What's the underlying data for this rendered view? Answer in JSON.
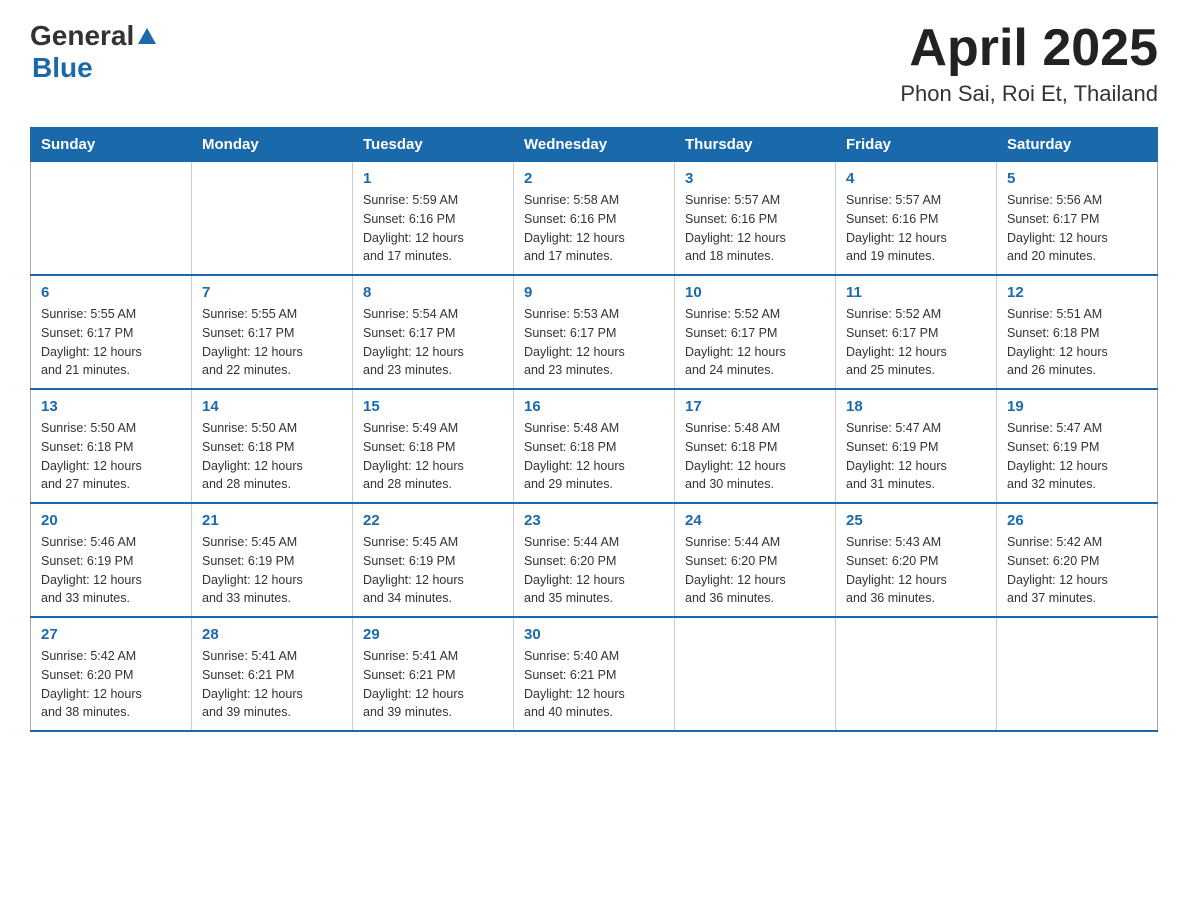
{
  "header": {
    "logo": {
      "general": "General",
      "blue": "Blue",
      "arrow": "▲"
    },
    "title": "April 2025",
    "subtitle": "Phon Sai, Roi Et, Thailand"
  },
  "calendar": {
    "weekdays": [
      "Sunday",
      "Monday",
      "Tuesday",
      "Wednesday",
      "Thursday",
      "Friday",
      "Saturday"
    ],
    "weeks": [
      [
        {
          "day": "",
          "info": ""
        },
        {
          "day": "",
          "info": ""
        },
        {
          "day": "1",
          "info": "Sunrise: 5:59 AM\nSunset: 6:16 PM\nDaylight: 12 hours\nand 17 minutes."
        },
        {
          "day": "2",
          "info": "Sunrise: 5:58 AM\nSunset: 6:16 PM\nDaylight: 12 hours\nand 17 minutes."
        },
        {
          "day": "3",
          "info": "Sunrise: 5:57 AM\nSunset: 6:16 PM\nDaylight: 12 hours\nand 18 minutes."
        },
        {
          "day": "4",
          "info": "Sunrise: 5:57 AM\nSunset: 6:16 PM\nDaylight: 12 hours\nand 19 minutes."
        },
        {
          "day": "5",
          "info": "Sunrise: 5:56 AM\nSunset: 6:17 PM\nDaylight: 12 hours\nand 20 minutes."
        }
      ],
      [
        {
          "day": "6",
          "info": "Sunrise: 5:55 AM\nSunset: 6:17 PM\nDaylight: 12 hours\nand 21 minutes."
        },
        {
          "day": "7",
          "info": "Sunrise: 5:55 AM\nSunset: 6:17 PM\nDaylight: 12 hours\nand 22 minutes."
        },
        {
          "day": "8",
          "info": "Sunrise: 5:54 AM\nSunset: 6:17 PM\nDaylight: 12 hours\nand 23 minutes."
        },
        {
          "day": "9",
          "info": "Sunrise: 5:53 AM\nSunset: 6:17 PM\nDaylight: 12 hours\nand 23 minutes."
        },
        {
          "day": "10",
          "info": "Sunrise: 5:52 AM\nSunset: 6:17 PM\nDaylight: 12 hours\nand 24 minutes."
        },
        {
          "day": "11",
          "info": "Sunrise: 5:52 AM\nSunset: 6:17 PM\nDaylight: 12 hours\nand 25 minutes."
        },
        {
          "day": "12",
          "info": "Sunrise: 5:51 AM\nSunset: 6:18 PM\nDaylight: 12 hours\nand 26 minutes."
        }
      ],
      [
        {
          "day": "13",
          "info": "Sunrise: 5:50 AM\nSunset: 6:18 PM\nDaylight: 12 hours\nand 27 minutes."
        },
        {
          "day": "14",
          "info": "Sunrise: 5:50 AM\nSunset: 6:18 PM\nDaylight: 12 hours\nand 28 minutes."
        },
        {
          "day": "15",
          "info": "Sunrise: 5:49 AM\nSunset: 6:18 PM\nDaylight: 12 hours\nand 28 minutes."
        },
        {
          "day": "16",
          "info": "Sunrise: 5:48 AM\nSunset: 6:18 PM\nDaylight: 12 hours\nand 29 minutes."
        },
        {
          "day": "17",
          "info": "Sunrise: 5:48 AM\nSunset: 6:18 PM\nDaylight: 12 hours\nand 30 minutes."
        },
        {
          "day": "18",
          "info": "Sunrise: 5:47 AM\nSunset: 6:19 PM\nDaylight: 12 hours\nand 31 minutes."
        },
        {
          "day": "19",
          "info": "Sunrise: 5:47 AM\nSunset: 6:19 PM\nDaylight: 12 hours\nand 32 minutes."
        }
      ],
      [
        {
          "day": "20",
          "info": "Sunrise: 5:46 AM\nSunset: 6:19 PM\nDaylight: 12 hours\nand 33 minutes."
        },
        {
          "day": "21",
          "info": "Sunrise: 5:45 AM\nSunset: 6:19 PM\nDaylight: 12 hours\nand 33 minutes."
        },
        {
          "day": "22",
          "info": "Sunrise: 5:45 AM\nSunset: 6:19 PM\nDaylight: 12 hours\nand 34 minutes."
        },
        {
          "day": "23",
          "info": "Sunrise: 5:44 AM\nSunset: 6:20 PM\nDaylight: 12 hours\nand 35 minutes."
        },
        {
          "day": "24",
          "info": "Sunrise: 5:44 AM\nSunset: 6:20 PM\nDaylight: 12 hours\nand 36 minutes."
        },
        {
          "day": "25",
          "info": "Sunrise: 5:43 AM\nSunset: 6:20 PM\nDaylight: 12 hours\nand 36 minutes."
        },
        {
          "day": "26",
          "info": "Sunrise: 5:42 AM\nSunset: 6:20 PM\nDaylight: 12 hours\nand 37 minutes."
        }
      ],
      [
        {
          "day": "27",
          "info": "Sunrise: 5:42 AM\nSunset: 6:20 PM\nDaylight: 12 hours\nand 38 minutes."
        },
        {
          "day": "28",
          "info": "Sunrise: 5:41 AM\nSunset: 6:21 PM\nDaylight: 12 hours\nand 39 minutes."
        },
        {
          "day": "29",
          "info": "Sunrise: 5:41 AM\nSunset: 6:21 PM\nDaylight: 12 hours\nand 39 minutes."
        },
        {
          "day": "30",
          "info": "Sunrise: 5:40 AM\nSunset: 6:21 PM\nDaylight: 12 hours\nand 40 minutes."
        },
        {
          "day": "",
          "info": ""
        },
        {
          "day": "",
          "info": ""
        },
        {
          "day": "",
          "info": ""
        }
      ]
    ]
  }
}
